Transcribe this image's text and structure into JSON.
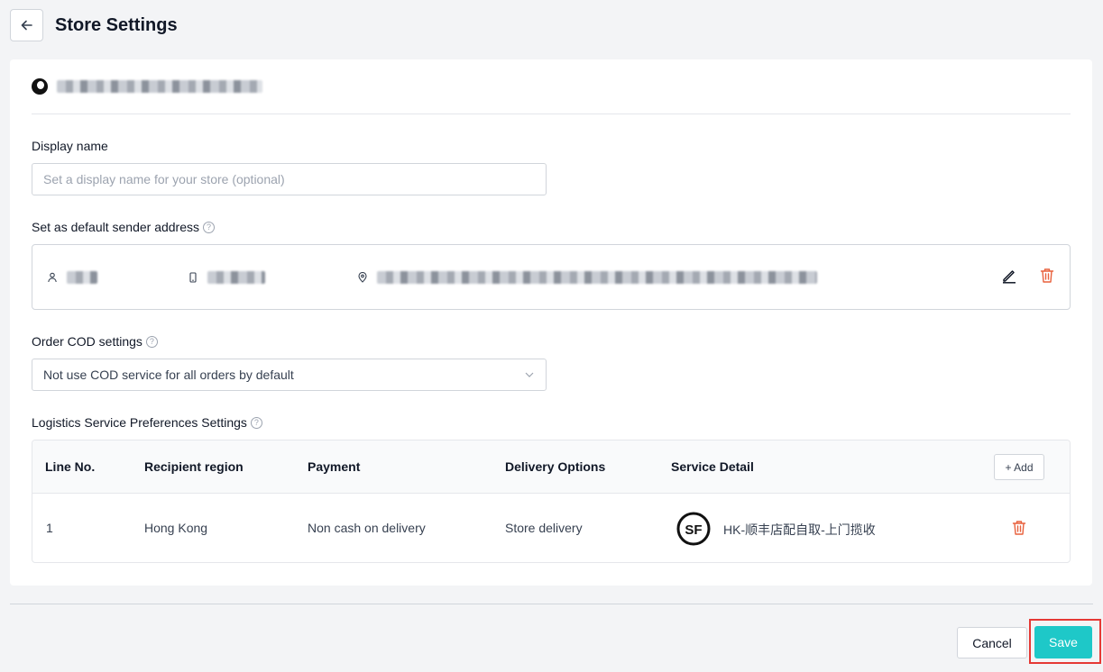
{
  "header": {
    "title": "Store Settings"
  },
  "form": {
    "display_name_label": "Display name",
    "display_name_placeholder": "Set a display name for your store (optional)",
    "display_name_value": "",
    "sender_label": "Set as default sender address",
    "cod_label": "Order COD settings",
    "cod_value": "Not use COD service for all orders by default",
    "logistics_label": "Logistics Service Preferences Settings",
    "help_glyph": "?"
  },
  "table": {
    "headers": [
      "Line No.",
      "Recipient region",
      "Payment",
      "Delivery Options",
      "Service Detail"
    ],
    "add_label": "+ Add",
    "rows": [
      {
        "line": "1",
        "region": "Hong Kong",
        "payment": "Non cash on delivery",
        "delivery": "Store delivery",
        "service": "HK-顺丰店配自取-上门揽收",
        "service_logo": "SF"
      }
    ]
  },
  "footer": {
    "cancel_label": "Cancel",
    "save_label": "Save"
  },
  "colors": {
    "accent": "#1ec8c8",
    "danger": "#e8603c",
    "highlight": "#e53935"
  },
  "icons": {
    "back": "arrow-left-icon",
    "person": "person-icon",
    "phone": "phone-icon",
    "location": "location-pin-icon",
    "edit": "pencil-icon",
    "delete": "trash-icon",
    "dropdown": "chevron-down-icon",
    "help": "question-circle-icon"
  }
}
